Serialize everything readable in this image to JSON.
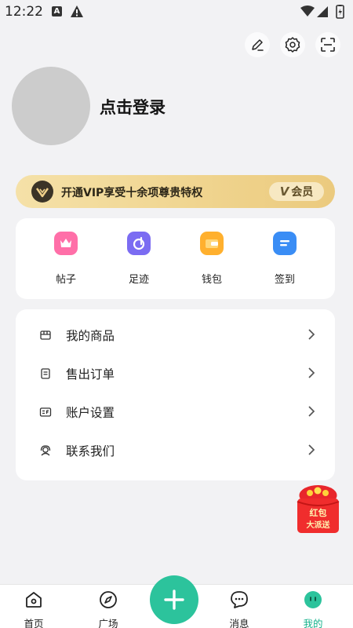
{
  "status_bar": {
    "time": "12:22",
    "notif_letter": "A"
  },
  "header": {
    "login_text": "点击登录"
  },
  "vip_banner": {
    "text": "开通VIP享受十余项尊贵特权",
    "badge_v": "V",
    "pill_label": "会员",
    "color_start": "#f5e1a8",
    "color_end": "#ebca7e"
  },
  "quick_actions": [
    {
      "label": "帖子",
      "icon": "crown-icon",
      "color": "#ff6fa8"
    },
    {
      "label": "足迹",
      "icon": "footprint-icon",
      "color": "#7b6cf2"
    },
    {
      "label": "钱包",
      "icon": "wallet-icon",
      "color": "#ffb02e"
    },
    {
      "label": "签到",
      "icon": "checkin-icon",
      "color": "#3a8df5"
    }
  ],
  "menu": [
    {
      "label": "我的商品",
      "icon": "store-icon"
    },
    {
      "label": "售出订单",
      "icon": "order-icon"
    },
    {
      "label": "账户设置",
      "icon": "account-icon"
    },
    {
      "label": "联系我们",
      "icon": "support-icon"
    }
  ],
  "red_packet": {
    "line1": "红包",
    "line2": "大派送"
  },
  "bottom_nav": {
    "items": [
      {
        "label": "首页",
        "icon": "home-icon"
      },
      {
        "label": "广场",
        "icon": "compass-icon"
      },
      {
        "label": "消息",
        "icon": "message-icon"
      },
      {
        "label": "我的",
        "icon": "profile-icon",
        "active": true
      }
    ],
    "accent": "#2cc39c"
  }
}
